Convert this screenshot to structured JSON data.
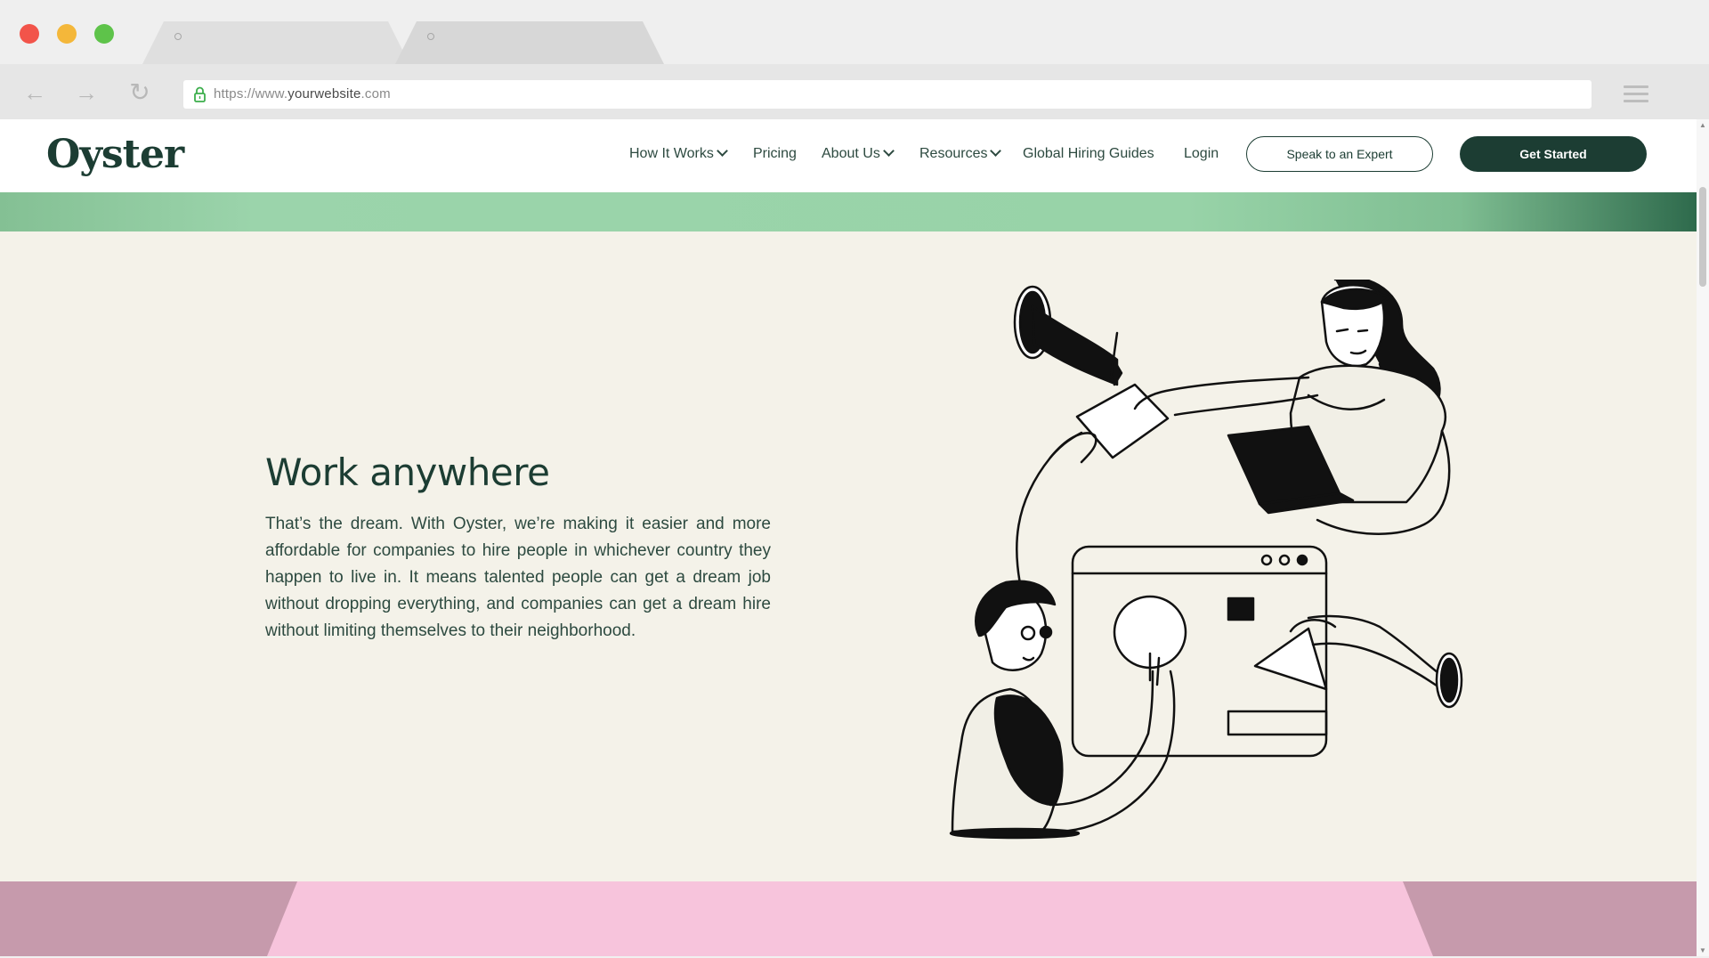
{
  "browser": {
    "url_prefix": "https://www.",
    "url_domain": "yourwebsite",
    "url_suffix": ".com",
    "back_icon": "←",
    "forward_icon": "→",
    "reload_icon": "↻"
  },
  "site": {
    "logo": "Oyster",
    "nav": {
      "how_it_works": "How It Works",
      "pricing": "Pricing",
      "about_us": "About Us",
      "resources": "Resources",
      "global_hiring_guides": "Global Hiring Guides",
      "login": "Login"
    },
    "speak_button": "Speak to an Expert",
    "get_started_button": "Get Started"
  },
  "main": {
    "headline": "Work anywhere",
    "paragraph": "That’s the dream. With Oyster, we’re making it easier and more affordable for companies to hire people in whichever country they happen to live in. It means talented people can get a dream job without dropping everything, and companies can get a dream hire without limiting themselves to their neighborhood."
  },
  "colors": {
    "brand_dark_green": "#1c3d33",
    "page_background": "#f4f2e9",
    "band_green": "#98d3a8",
    "band_pink": "#f7c4dc"
  }
}
